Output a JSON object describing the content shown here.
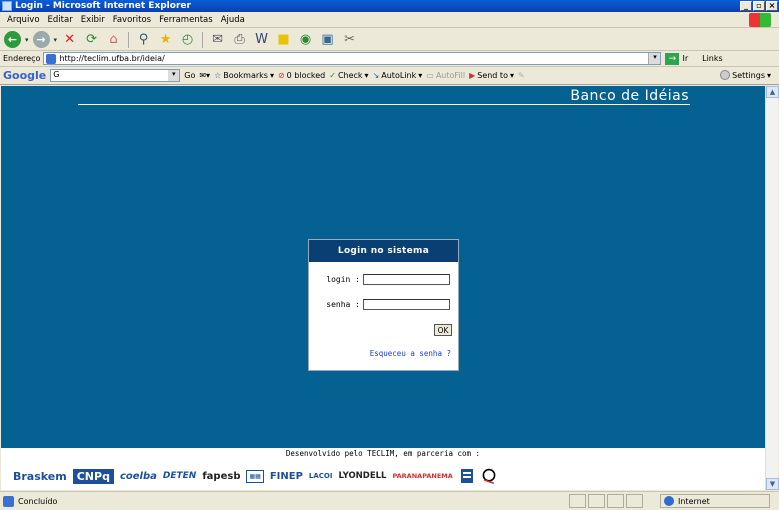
{
  "window": {
    "title": "Login - Microsoft Internet Explorer",
    "controls": [
      "_",
      "▫",
      "×"
    ]
  },
  "menu": [
    "Arquivo",
    "Editar",
    "Exibir",
    "Favoritos",
    "Ferramentas",
    "Ajuda"
  ],
  "address": {
    "label": "Endereço",
    "url": "http://teclim.ufba.br/ideia/",
    "go_label": "Ir",
    "links_label": "Links"
  },
  "googlebar": {
    "logo": "Google",
    "search_value": "G",
    "go_label": "Go",
    "bookmarks_label": "Bookmarks",
    "blocked_label": "0 blocked",
    "check_label": "Check",
    "autolink_label": "AutoLink",
    "autofill_label": "AutoFill",
    "sendto_label": "Send to",
    "settings_label": "Settings"
  },
  "page": {
    "site_title": "Banco de Idéias",
    "login": {
      "header": "Login no sistema",
      "login_label": "login :",
      "password_label": "senha :",
      "login_value": "",
      "password_value": "",
      "ok_label": "OK",
      "forgot_label": "Esqueceu a senha ?"
    },
    "developed_text": "Desenvolvido pelo TECLIM, em parceria com :",
    "partners": [
      "Braskem",
      "CNPq",
      "coelba",
      "DETEN",
      "fapesb",
      "FINEP",
      "LACOI",
      "LYONDELL",
      "PARANAPANEMA"
    ]
  },
  "status": {
    "text": "Concluído",
    "zone": "Internet"
  }
}
